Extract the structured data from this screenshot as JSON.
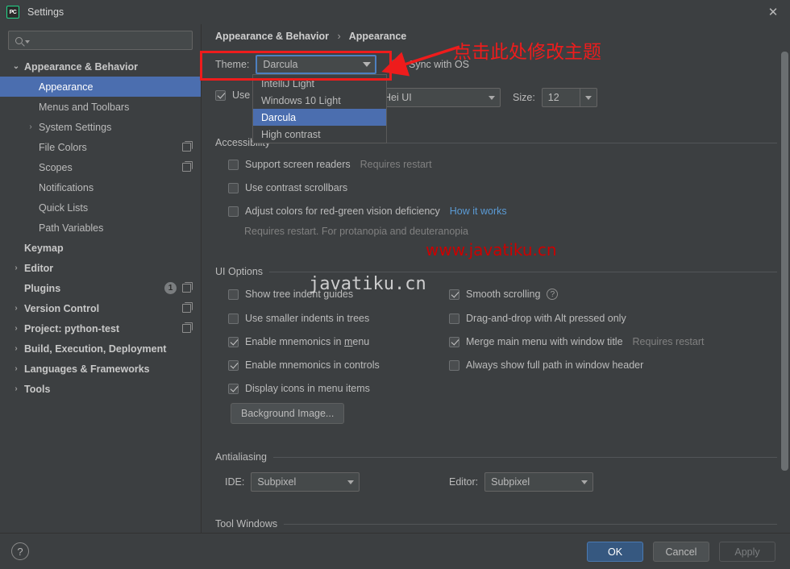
{
  "window": {
    "title": "Settings",
    "app_icon": "pycharm-icon",
    "close_icon": "close-icon"
  },
  "sidebar": {
    "search": {
      "placeholder": "",
      "value": "",
      "icon": "search-icon"
    },
    "items": [
      {
        "label": "Appearance & Behavior",
        "level": 0,
        "bold": true,
        "arrow": "down",
        "selected": false,
        "copy": false
      },
      {
        "label": "Appearance",
        "level": 1,
        "bold": false,
        "arrow": "none",
        "selected": true,
        "copy": false
      },
      {
        "label": "Menus and Toolbars",
        "level": 1,
        "bold": false,
        "arrow": "none",
        "selected": false,
        "copy": false
      },
      {
        "label": "System Settings",
        "level": 1,
        "bold": false,
        "arrow": "right",
        "selected": false,
        "copy": false
      },
      {
        "label": "File Colors",
        "level": 1,
        "bold": false,
        "arrow": "none",
        "selected": false,
        "copy": true
      },
      {
        "label": "Scopes",
        "level": 1,
        "bold": false,
        "arrow": "none",
        "selected": false,
        "copy": true
      },
      {
        "label": "Notifications",
        "level": 1,
        "bold": false,
        "arrow": "none",
        "selected": false,
        "copy": false
      },
      {
        "label": "Quick Lists",
        "level": 1,
        "bold": false,
        "arrow": "none",
        "selected": false,
        "copy": false
      },
      {
        "label": "Path Variables",
        "level": 1,
        "bold": false,
        "arrow": "none",
        "selected": false,
        "copy": false
      },
      {
        "label": "Keymap",
        "level": 0,
        "bold": true,
        "arrow": "none",
        "selected": false,
        "copy": false
      },
      {
        "label": "Editor",
        "level": 0,
        "bold": true,
        "arrow": "right",
        "selected": false,
        "copy": false
      },
      {
        "label": "Plugins",
        "level": 0,
        "bold": true,
        "arrow": "none",
        "selected": false,
        "copy": true,
        "badge": "1"
      },
      {
        "label": "Version Control",
        "level": 0,
        "bold": true,
        "arrow": "right",
        "selected": false,
        "copy": true
      },
      {
        "label": "Project: python-test",
        "level": 0,
        "bold": true,
        "arrow": "right",
        "selected": false,
        "copy": true
      },
      {
        "label": "Build, Execution, Deployment",
        "level": 0,
        "bold": true,
        "arrow": "right",
        "selected": false,
        "copy": false
      },
      {
        "label": "Languages & Frameworks",
        "level": 0,
        "bold": true,
        "arrow": "right",
        "selected": false,
        "copy": false
      },
      {
        "label": "Tools",
        "level": 0,
        "bold": true,
        "arrow": "right",
        "selected": false,
        "copy": false
      }
    ]
  },
  "main": {
    "breadcrumb": {
      "root": "Appearance & Behavior",
      "separator": "›",
      "leaf": "Appearance"
    },
    "theme": {
      "label": "Theme:",
      "value": "Darcula",
      "sync_label": "Sync with OS",
      "sync_checked": false,
      "options": [
        {
          "label": "IntelliJ Light",
          "selected": false
        },
        {
          "label": "Windows 10 Light",
          "selected": false
        },
        {
          "label": "Darcula",
          "selected": true
        },
        {
          "label": "High contrast",
          "selected": false
        }
      ]
    },
    "font": {
      "use_label": "Use",
      "use_checked": true,
      "font_value": "Hei UI",
      "size_label": "Size:",
      "size_value": "12"
    },
    "accessibility": {
      "title": "Accessibility",
      "items": [
        {
          "label": "Support screen readers",
          "checked": false,
          "hint": "Requires restart",
          "link": ""
        },
        {
          "label": "Use contrast scrollbars",
          "checked": false,
          "hint": "",
          "link": ""
        },
        {
          "label": "Adjust colors for red-green vision deficiency",
          "checked": false,
          "hint": "",
          "link": "How it works"
        }
      ],
      "note": "Requires restart. For protanopia and deuteranopia"
    },
    "ui_options": {
      "title": "UI Options",
      "left": [
        {
          "label": "Show tree indent guides",
          "checked": false
        },
        {
          "label": "Use smaller indents in trees",
          "checked": false
        },
        {
          "label": "Enable mnemonics in menu",
          "checked": true,
          "mnemonic": "m"
        },
        {
          "label": "Enable mnemonics in controls",
          "checked": true
        },
        {
          "label": "Display icons in menu items",
          "checked": true
        }
      ],
      "right": [
        {
          "label": "Smooth scrolling",
          "checked": true,
          "help": true,
          "hint": ""
        },
        {
          "label": "Drag-and-drop with Alt pressed only",
          "checked": false,
          "help": false,
          "hint": ""
        },
        {
          "label": "Merge main menu with window title",
          "checked": true,
          "help": false,
          "hint": "Requires restart"
        },
        {
          "label": "Always show full path in window header",
          "checked": false,
          "help": false,
          "hint": ""
        }
      ],
      "background_image_button": "Background Image..."
    },
    "antialiasing": {
      "title": "Antialiasing",
      "ide_label": "IDE:",
      "ide_value": "Subpixel",
      "editor_label": "Editor:",
      "editor_value": "Subpixel"
    },
    "tool_windows": {
      "title": "Tool Windows"
    }
  },
  "footer": {
    "help_icon": "?",
    "ok": "OK",
    "cancel": "Cancel",
    "apply": "Apply"
  },
  "annotations": {
    "callout_text": "点击此处修改主题",
    "watermark_red": "www.javatiku.cn",
    "watermark_gray": "javatiku.cn",
    "accent_red": "#ee1c1c",
    "accent_blue": "#4b6eaf"
  }
}
